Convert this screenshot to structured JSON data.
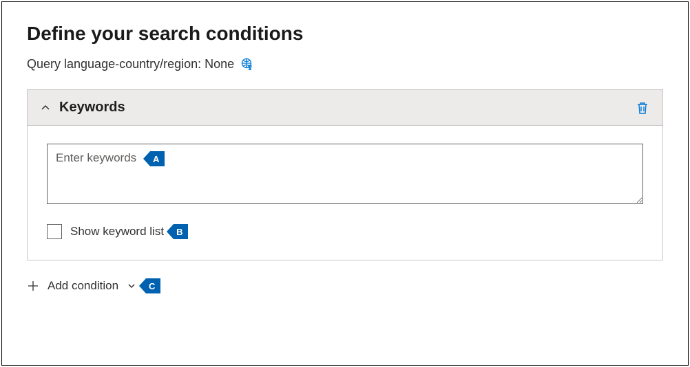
{
  "page": {
    "title": "Define your search conditions",
    "sub_label": "Query language-country/region: None"
  },
  "panel": {
    "title": "Keywords",
    "keyword_placeholder": "Enter keywords",
    "show_list_label": "Show keyword list"
  },
  "actions": {
    "add_condition": "Add condition"
  },
  "tags": {
    "a": "A",
    "b": "B",
    "c": "C"
  }
}
